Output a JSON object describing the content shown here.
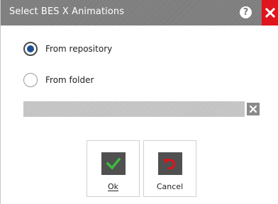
{
  "window": {
    "title": "Select BES X Animations",
    "help_symbol": "?",
    "close_icon": "close-icon",
    "accent_color": "#e0141c"
  },
  "source": {
    "options": [
      {
        "label": "From repository",
        "checked": true
      },
      {
        "label": "From folder",
        "checked": false
      }
    ],
    "path_value": "",
    "clear_icon": "clear-icon"
  },
  "buttons": {
    "ok_label": "Ok",
    "ok_icon": "checkmark-icon",
    "cancel_label": "Cancel",
    "cancel_icon": "undo-arrow-icon"
  }
}
